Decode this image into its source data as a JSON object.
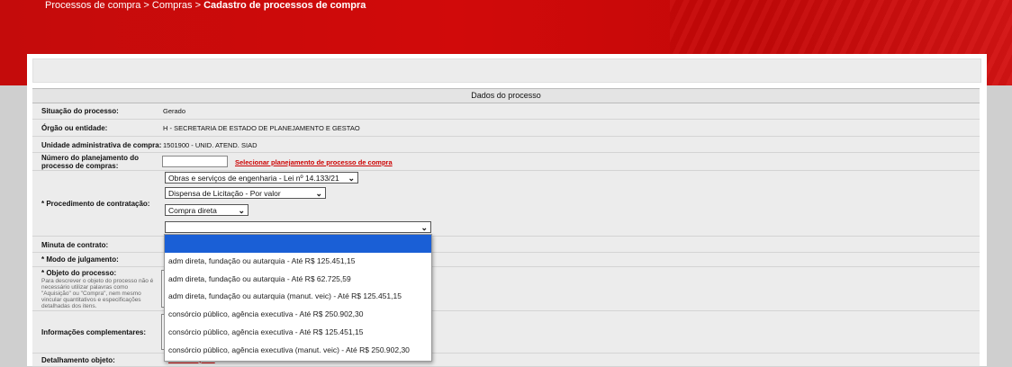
{
  "breadcrumb": {
    "path": "Processos de compra > Compras > ",
    "current": "Cadastro de processos de compra"
  },
  "section_title": "Dados do processo",
  "fields": {
    "situacao": {
      "label": "Situação do processo:",
      "value": "Gerado"
    },
    "orgao": {
      "label": "Órgão ou entidade:",
      "value": "H - SECRETARIA DE ESTADO DE PLANEJAMENTO E GESTAO"
    },
    "unidade": {
      "label": "Unidade administrativa de compra:",
      "value": "1501900 - UNID. ATEND. SIAD"
    },
    "planejamento": {
      "label": "Número do planejamento do processo de compras:",
      "value": "",
      "link": "Selecionar planejamento de processo de compra"
    },
    "procedimento": {
      "label": "* Procedimento de contratação:",
      "select1": "Obras e serviços de engenharia - Lei nº 14.133/21",
      "select2": "Dispensa de Licitação - Por valor",
      "select3": "Compra direta",
      "select4": ""
    },
    "minuta": {
      "label": "Minuta de contrato:"
    },
    "modo": {
      "label": "* Modo de julgamento:"
    },
    "objeto": {
      "label": "* Objeto do processo:",
      "help": "Para descrever o objeto do processo não é necessário utilizar palavras como \"Aquisição\" ou \"Compra\", nem mesmo vincular quantitativos e especificações detalhadas dos itens."
    },
    "informacoes": {
      "label": "Informações complementares:"
    },
    "detalhamento": {
      "label": "Detalhamento objeto:",
      "link": "Incluir arquivo"
    }
  },
  "dropdown_options": [
    "",
    "adm direta, fundação ou autarquia - Até R$ 125.451,15",
    "adm direta, fundação ou autarquia - Até R$ 62.725,59",
    "adm direta, fundação ou autarquia (manut. veic) - Até R$ 125.451,15",
    "consórcio público, agência executiva - Até R$ 250.902,30",
    "consórcio público, agência executiva - Até R$ 125.451,15",
    "consórcio público, agência executiva (manut. veic) - Até R$ 250.902,30"
  ],
  "colors": {
    "banner": "#c40b0b",
    "highlight": "#1a5fd6",
    "link": "#cc0000"
  }
}
